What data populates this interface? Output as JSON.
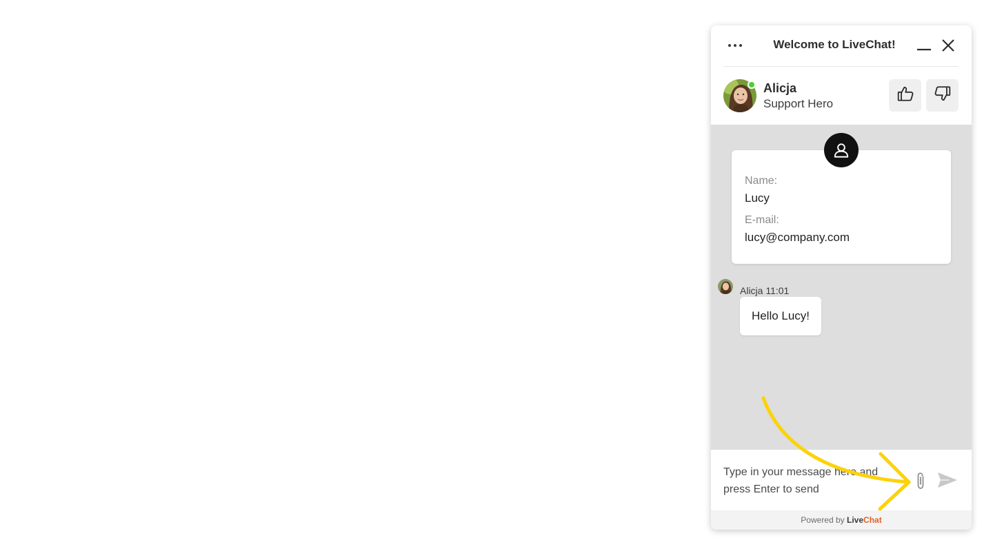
{
  "widget": {
    "title": "Welcome to LiveChat!",
    "menu_icon": "more-dots-icon",
    "minimize_icon": "minimize-icon",
    "close_icon": "close-icon"
  },
  "agent": {
    "name": "Alicja",
    "role": "Support Hero",
    "status": "online",
    "status_color": "#4ad12e",
    "rate_up_icon": "thumbs-up-icon",
    "rate_down_icon": "thumbs-down-icon"
  },
  "prechat_card": {
    "icon": "user-icon",
    "fields": [
      {
        "label": "Name:",
        "value": "Lucy"
      },
      {
        "label": "E-mail:",
        "value": "lucy@company.com"
      }
    ]
  },
  "messages": [
    {
      "author": "Alicja",
      "time": "11:01",
      "meta": "Alicja 11:01",
      "text": "Hello Lucy!"
    }
  ],
  "composer": {
    "placeholder_line1": "Type in your message here and",
    "placeholder_line2": "press Enter to send",
    "attach_icon": "paperclip-icon",
    "send_icon": "send-icon"
  },
  "footer": {
    "prefix": "Powered by",
    "brand_part1": "Live",
    "brand_part2": "Chat",
    "brand_color": "#e0622a"
  },
  "annotation": {
    "type": "hand-drawn-arrow",
    "color": "#fcd20a",
    "points_to": "paperclip-icon"
  }
}
